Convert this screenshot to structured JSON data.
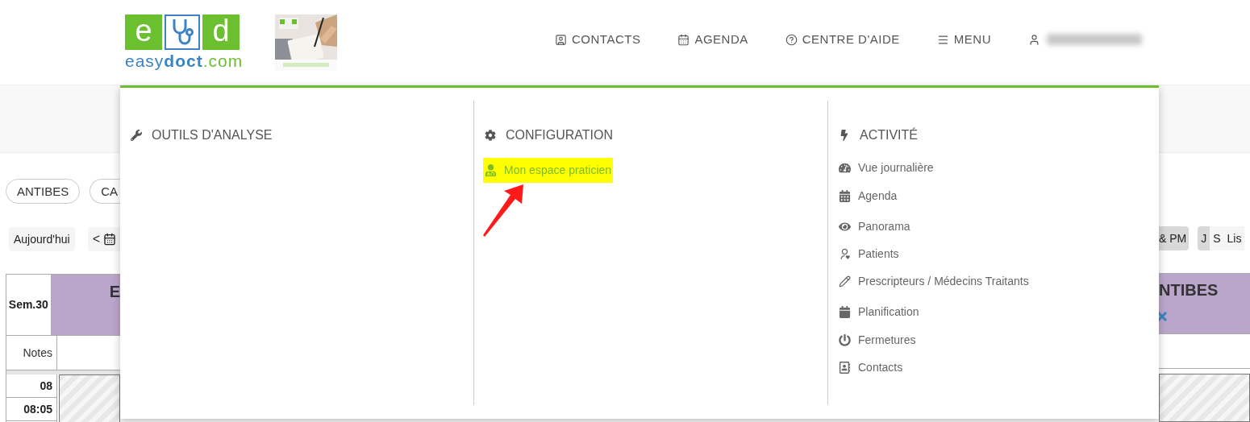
{
  "logo": {
    "letters": [
      "e",
      "d"
    ],
    "wordmark": [
      "easy",
      "doct",
      ".com"
    ]
  },
  "nav": [
    {
      "label": "CONTACTS"
    },
    {
      "label": "AGENDA"
    },
    {
      "label": "CENTRE D'AIDE"
    },
    {
      "label": "MENU"
    }
  ],
  "user": {
    "name_blurred": true
  },
  "background_left": {
    "pills": [
      "ANTIBES",
      "CA"
    ],
    "today_button": "Aujourd'hui",
    "prev": "<",
    "week": "Sem.30",
    "header_cut": "E",
    "notes": "Notes",
    "times": [
      "08",
      "08:05"
    ]
  },
  "background_right": {
    "period_button": "& PM",
    "views": [
      {
        "label": "J",
        "selected": true
      },
      {
        "label": "S",
        "selected": false
      },
      {
        "label": "Lis",
        "selected": false
      }
    ],
    "header_cut": "NTIBES"
  },
  "menu": {
    "columns": [
      {
        "title": "OUTILS D'ANALYSE"
      },
      {
        "title": "CONFIGURATION",
        "items": [
          {
            "label": "Mon espace praticien",
            "highlighted": true
          }
        ],
        "annotation_arrow": true
      },
      {
        "title": "ACTIVITÉ",
        "items": [
          {
            "label": "Vue journalière",
            "highlighted": false
          },
          {
            "label": "Agenda",
            "highlighted": false
          },
          {
            "label": "Panorama",
            "highlighted": false
          },
          {
            "label": "Patients",
            "highlighted": false
          },
          {
            "label": "Prescripteurs / Médecins Traitants",
            "highlighted": false
          },
          {
            "label": "Planification",
            "highlighted": false
          },
          {
            "label": "Fermetures",
            "highlighted": false
          },
          {
            "label": "Contacts",
            "highlighted": false
          }
        ]
      }
    ]
  }
}
